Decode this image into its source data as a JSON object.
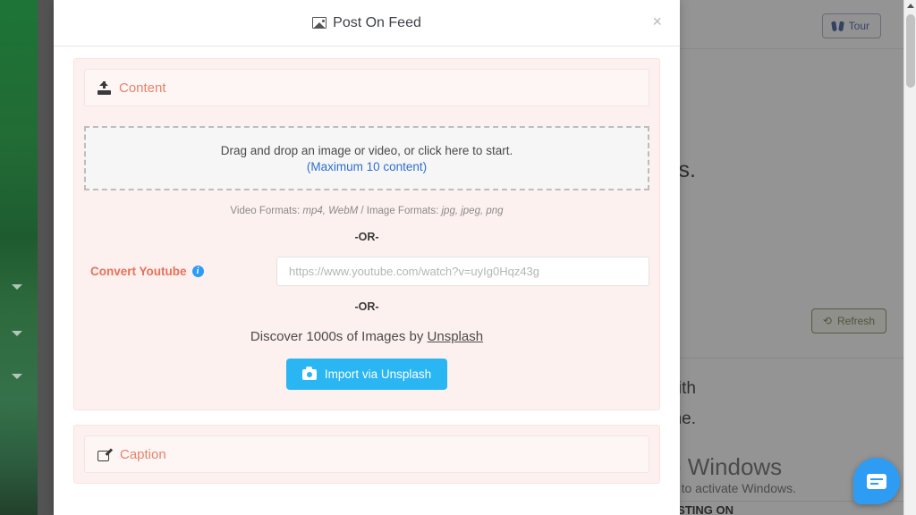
{
  "background": {
    "tour_button": "Tour",
    "refresh_button": "Refresh",
    "headline_fragment": "es.",
    "paragraph_line1": "with",
    "paragraph_line2": "ne.",
    "watermark_title": "Activate Windows",
    "watermark_subtitle": "Go to Settings to activate Windows.",
    "bottom_banner": "DIRECT LONG VIDEO POSTING ON"
  },
  "modal": {
    "title": "Post On Feed",
    "close_label": "×",
    "content_section": {
      "label": "Content",
      "dropzone_main": "Drag and drop an image or video, or click here to start.",
      "dropzone_sub": "(Maximum 10 content)",
      "formats_prefix": "Video Formats:",
      "formats_video": "mp4, WebM",
      "formats_separator": "/ Image Formats:",
      "formats_image": "jpg, jpeg, png",
      "or_label_1": "-OR-",
      "youtube_label": "Convert Youtube",
      "youtube_info": "i",
      "youtube_placeholder": "https://www.youtube.com/watch?v=uyIg0Hqz43g",
      "youtube_value": "",
      "or_label_2": "-OR-",
      "discover_text": "Discover 1000s of Images by",
      "discover_link": "Unsplash",
      "unsplash_button": "Import via Unsplash"
    },
    "caption_section": {
      "label": "Caption"
    }
  },
  "colors": {
    "accent_salmon": "#e8826a",
    "panel_pink": "#fdf1ef",
    "link_blue": "#2f6fd0",
    "unsplash_blue": "#29b6f2",
    "sidebar_green": "#1d7436"
  }
}
